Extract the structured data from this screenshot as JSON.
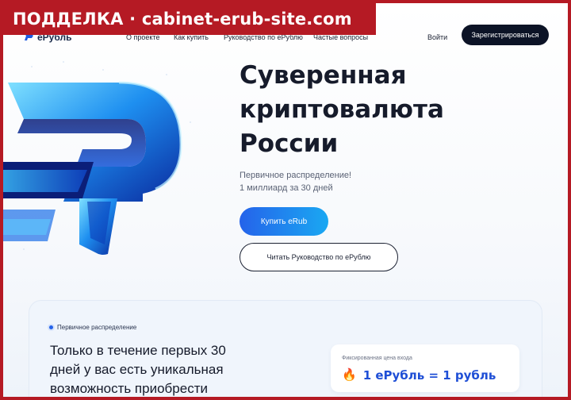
{
  "warning_banner": "ПОДДЕЛКА · cabinet-erub-site.com",
  "header": {
    "logo_text": "eРубль",
    "nav": [
      "О проекте",
      "Как купить",
      "Руководство по eРублю",
      "Частые вопросы"
    ],
    "login": "Войти",
    "signup": "Зарегистрироваться"
  },
  "hero": {
    "title_lines": [
      "Суверенная",
      "криптовалюта",
      "России"
    ],
    "subtitle_lines": [
      "Первичное распределение!",
      "1 миллиард за 30 дней"
    ],
    "buy_button": "Купить eRub",
    "guide_button": "Читать Руководство по eРублю"
  },
  "section": {
    "badge": "Первичное распределение",
    "text_lines": [
      "Только в течение первых 30",
      "дней у вас есть уникальная",
      "возможность приобрести"
    ],
    "price_label": "Фиксированная цена входа",
    "price_icon": "fire-icon",
    "price_text": "1 eРубль = 1 рубль"
  },
  "colors": {
    "banner": "#b51a24",
    "primary_dark": "#0c1326",
    "accent_blue": "#2563ea"
  }
}
